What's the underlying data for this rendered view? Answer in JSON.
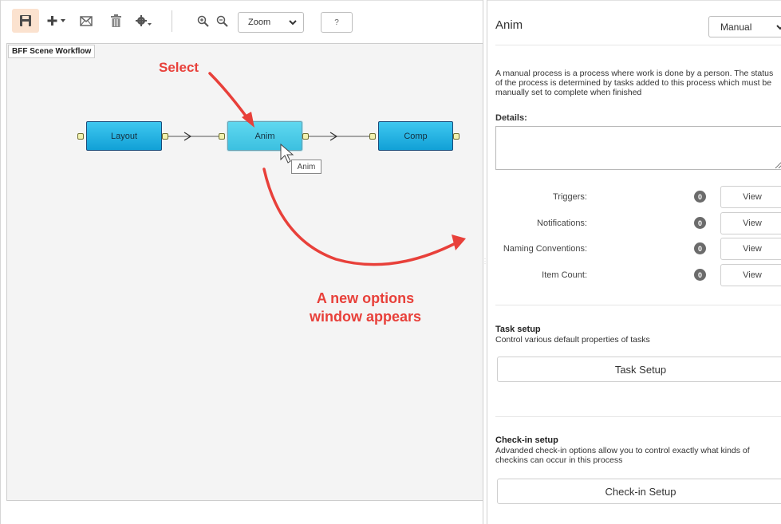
{
  "toolbar": {
    "save_icon": "save-icon",
    "add_icon": "add-icon",
    "mail_icon": "envelope-icon",
    "delete_icon": "trash-icon",
    "settings_icon": "gear-icon",
    "zoom_in_icon": "zoom-in-icon",
    "zoom_out_icon": "zoom-out-icon",
    "zoom_select_value": "Zoom",
    "help_label": "?"
  },
  "canvas": {
    "title": "BFF Scene Workflow",
    "nodes": [
      {
        "label": "Layout",
        "selected": false
      },
      {
        "label": "Anim",
        "selected": true
      },
      {
        "label": "Comp",
        "selected": false
      }
    ],
    "tooltip": "Anim"
  },
  "annotations": {
    "select": "Select",
    "new_window_line1": "A new options",
    "new_window_line2": "window appears",
    "color": "#e8403a"
  },
  "properties": {
    "process_name": "Anim",
    "process_type": "Manual",
    "description": "A manual process is a process where work is done by a person. The status of the process is determined by tasks added to this process which must be manually set to complete when finished",
    "details_label": "Details:",
    "details_value": "",
    "rows": [
      {
        "label": "Triggers:",
        "count": "0",
        "button": "View"
      },
      {
        "label": "Notifications:",
        "count": "0",
        "button": "View"
      },
      {
        "label": "Naming Conventions:",
        "count": "0",
        "button": "View"
      },
      {
        "label": "Item Count:",
        "count": "0",
        "button": "View"
      }
    ],
    "task_setup": {
      "title": "Task setup",
      "description": "Control various default properties of tasks",
      "button": "Task Setup"
    },
    "checkin_setup": {
      "title": "Check-in setup",
      "description": "Advanded check-in options allow you to control exactly what kinds of checkins can occur in this process",
      "button": "Check-in Setup"
    }
  },
  "colors": {
    "node_fill": "#11a0d6",
    "node_selected_fill": "#3cc0e0",
    "save_highlight": "#fbe2cf"
  }
}
